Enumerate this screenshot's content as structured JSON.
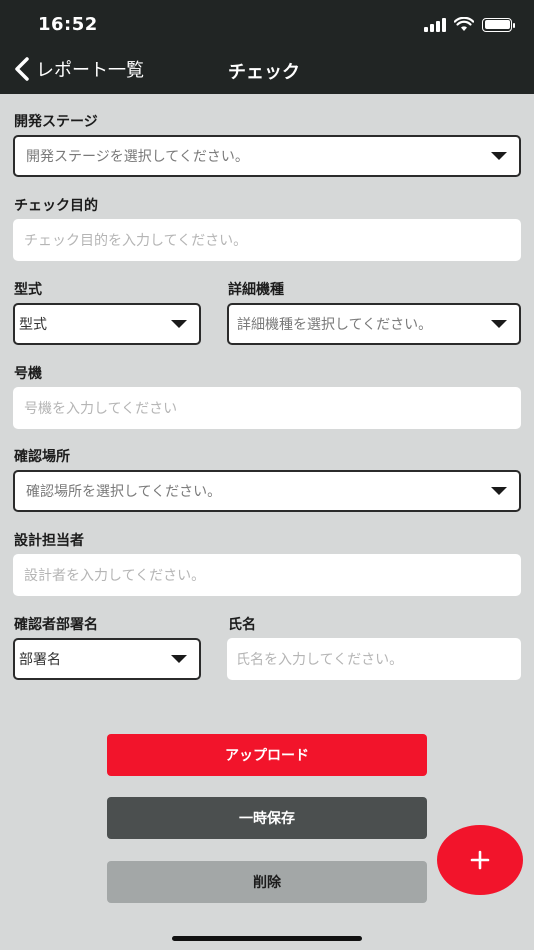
{
  "status": {
    "time": "16:52"
  },
  "nav": {
    "back_label": "レポート一覧",
    "title": "チェック"
  },
  "form": {
    "stage": {
      "label": "開発ステージ",
      "placeholder": "開発ステージを選択してください。"
    },
    "purpose": {
      "label": "チェック目的",
      "placeholder": "チェック目的を入力してください。"
    },
    "model": {
      "label": "型式",
      "placeholder": "型式"
    },
    "detail_model": {
      "label": "詳細機種",
      "placeholder": "詳細機種を選択してください。"
    },
    "unit_no": {
      "label": "号機",
      "placeholder": "号機を入力してください"
    },
    "location": {
      "label": "確認場所",
      "placeholder": "確認場所を選択してください。"
    },
    "designer": {
      "label": "設計担当者",
      "placeholder": "設計者を入力してください。"
    },
    "confirmer_dept": {
      "label": "確認者部署名",
      "placeholder": "部署名"
    },
    "name": {
      "label": "氏名",
      "placeholder": "氏名を入力してください。"
    }
  },
  "buttons": {
    "upload": "アップロード",
    "save_draft": "一時保存",
    "delete": "削除"
  },
  "colors": {
    "accent": "#f2142b",
    "header": "#212524",
    "background": "#d6d8d8"
  }
}
